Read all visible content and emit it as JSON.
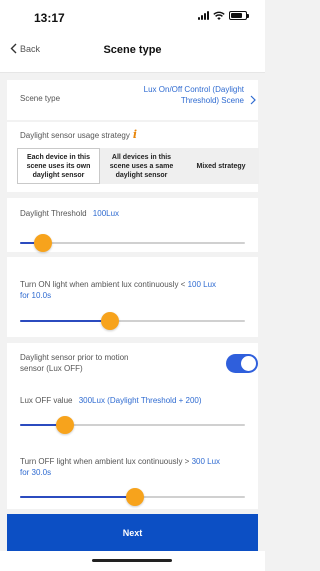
{
  "status_bar": {
    "time": "13:17",
    "battery_level": 0.8
  },
  "nav": {
    "back_label": "Back",
    "title": "Scene type"
  },
  "scene_type": {
    "label": "Scene type",
    "value_line1": "Lux On/Off Control (Daylight",
    "value_line2": "Threshold) Scene"
  },
  "strategy": {
    "label": "Daylight sensor usage strategy",
    "info_glyph": "i",
    "options": [
      {
        "lines": [
          "Each device in this",
          "scene uses its own",
          "daylight sensor"
        ],
        "selected": true
      },
      {
        "lines": [
          "All devices in this",
          "scene uses a same",
          "daylight sensor"
        ],
        "selected": false
      },
      {
        "lines": [
          "Mixed strategy"
        ],
        "selected": false
      }
    ]
  },
  "daylight_threshold": {
    "label": "Daylight Threshold",
    "value": "100Lux",
    "level": 0.1
  },
  "turn_on": {
    "label": "Turn ON light when ambient lux continuously <",
    "value_inline": "100 Lux",
    "value_line2": "for 10.0s",
    "level": 0.4
  },
  "prior_motion": {
    "label_line1": "Daylight sensor prior to motion",
    "label_line2": "sensor (Lux OFF)",
    "enabled": true
  },
  "lux_off": {
    "label": "Lux OFF value",
    "value": "300Lux  (Daylight Threshold + 200)",
    "level": 0.2
  },
  "turn_off": {
    "label": "Turn OFF light when ambient lux continuously >",
    "value_inline": "300 Lux",
    "value_line2": "for 30.0s",
    "level": 0.51
  },
  "next_label": "Next",
  "colors": {
    "accent": "#0c4fc4",
    "link": "#2f6bd1",
    "thumb": "#f7a31c",
    "track_fill": "#2b4bbf",
    "info": "#e8860b"
  },
  "icons": {
    "back": "chevron-left-icon",
    "row": "chevron-right-icon",
    "info": "info-icon"
  }
}
